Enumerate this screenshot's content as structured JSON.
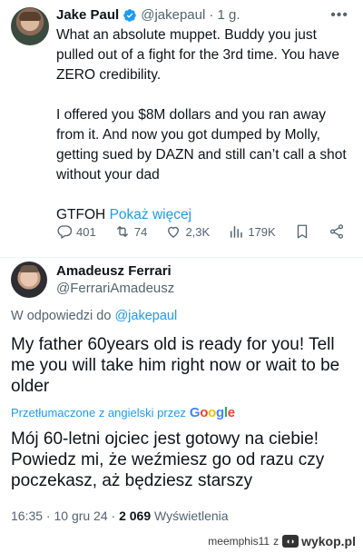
{
  "tweet1": {
    "name": "Jake Paul",
    "handle": "@jakepaul",
    "time": "· 1 g.",
    "lines": [
      "What an absolute muppet. Buddy you just pulled out of a fight for the 3rd time. You have ZERO credibility.",
      "I offered you $8M dollars and you ran away from it. And now you got dumped by Molly, getting sued by DAZN and still can’t call a shot without your dad",
      "GTFOH"
    ],
    "show_more": "Pokaż więcej",
    "stats": {
      "replies": "401",
      "retweets": "74",
      "likes": "2,3K",
      "views": "179K"
    }
  },
  "tweet2": {
    "name": "Amadeusz Ferrari",
    "handle": "@FerrariAmadeusz",
    "reply_prefix": "W odpowiedzi do",
    "reply_handle": "@jakepaul",
    "text": "My father 60years old is ready for you! Tell me you will take him right now or wait to be older",
    "translated_label": "Przetłumaczone z angielski przez",
    "google": "Google",
    "translation": "Mój 60-letni ojciec jest gotowy na ciebie! Powiedz mi, że weźmiesz go od razu czy poczekasz, aż będziesz starszy",
    "timestamp": "16:35 · 10 gru 24 ·",
    "view_count": "2 069",
    "views_label": "Wyświetlenia"
  },
  "footer": {
    "user": "meemphis11",
    "sep": "z",
    "site": "wykop.pl"
  },
  "colors": {
    "link": "#1d9bf0",
    "muted": "#536471",
    "text": "#0f1419"
  }
}
